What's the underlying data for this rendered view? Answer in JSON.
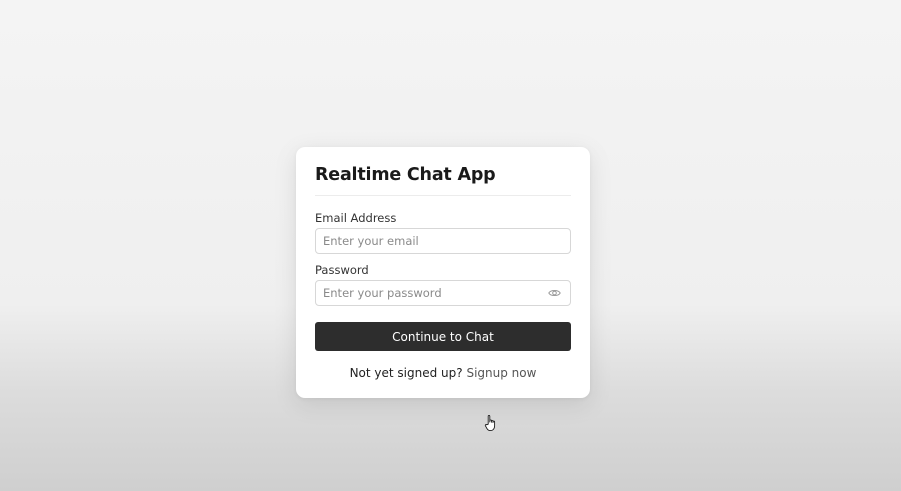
{
  "card": {
    "title": "Realtime Chat App"
  },
  "email": {
    "label": "Email Address",
    "placeholder": "Enter your email",
    "value": ""
  },
  "password": {
    "label": "Password",
    "placeholder": "Enter your password",
    "value": "",
    "toggle_icon": "eye-icon"
  },
  "submit": {
    "label": "Continue to Chat"
  },
  "signup": {
    "prompt": "Not yet signed up?",
    "link_label": "Signup now"
  },
  "cursor": {
    "icon": "hand-pointer-icon"
  },
  "colors": {
    "button_bg": "#2d2d2d",
    "button_text": "#ffffff",
    "card_bg": "#ffffff",
    "page_bg": "#f0f0f0"
  }
}
